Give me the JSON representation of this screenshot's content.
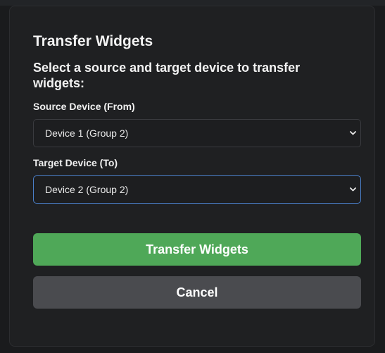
{
  "dialog": {
    "title": "Transfer Widgets",
    "subtitle": "Select a source and target device to transfer widgets:",
    "source": {
      "label": "Source Device (From)",
      "selected": "Device 1 (Group 2)"
    },
    "target": {
      "label": "Target Device (To)",
      "selected": "Device 2 (Group 2)"
    },
    "transfer_label": "Transfer Widgets",
    "cancel_label": "Cancel"
  },
  "colors": {
    "primary": "#4fa858",
    "secondary": "#4a4b4f",
    "focus": "#4a7fc9",
    "background": "#1f2022"
  },
  "icons": {
    "select_arrow": "chevron-down-icon"
  }
}
